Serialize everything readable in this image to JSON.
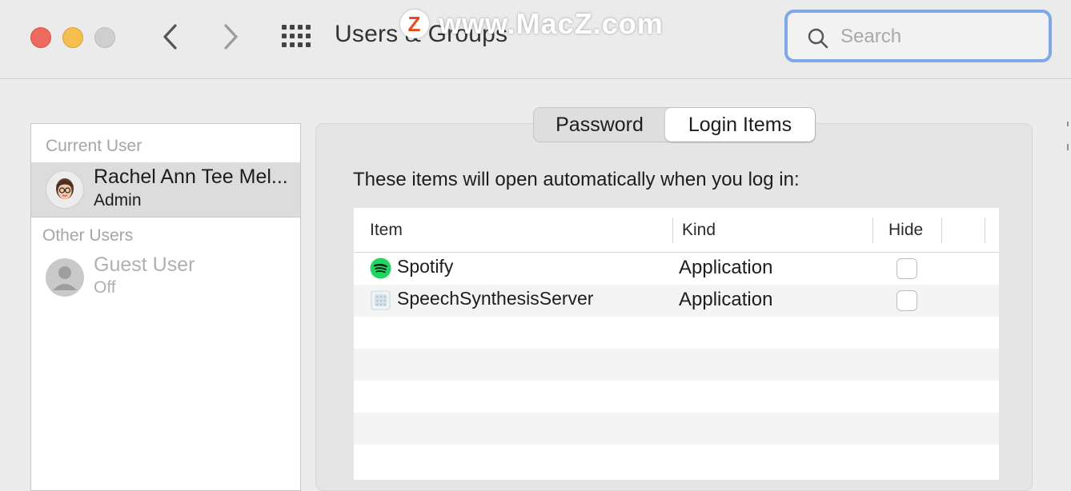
{
  "window": {
    "title": "Users & Groups",
    "watermark_text": "www.MacZ.com",
    "watermark_logo": "Z"
  },
  "toolbar": {
    "back_icon": "chevron-left-icon",
    "forward_icon": "chevron-right-icon",
    "grid_icon": "grid-icon"
  },
  "search": {
    "placeholder": "Search",
    "value": ""
  },
  "sidebar": {
    "current_user_label": "Current User",
    "current_user": {
      "name": "Rachel Ann Tee Mel...",
      "role": "Admin"
    },
    "other_users_label": "Other Users",
    "other_users": [
      {
        "name": "Guest User",
        "status": "Off"
      }
    ]
  },
  "tabs": [
    {
      "label": "Password",
      "selected": false
    },
    {
      "label": "Login Items",
      "selected": true
    }
  ],
  "login_items": {
    "description": "These items will open automatically when you log in:",
    "columns": [
      "Item",
      "Kind",
      "Hide"
    ],
    "rows": [
      {
        "item": "Spotify",
        "kind": "Application",
        "hide": false,
        "icon": "spotify-icon"
      },
      {
        "item": "SpeechSynthesisServer",
        "kind": "Application",
        "hide": false,
        "icon": "speech-synthesis-icon"
      }
    ]
  },
  "colors": {
    "close": "#ed6a5e",
    "minimize": "#f5bf4f",
    "search_focus": "#7fa9e6",
    "spotify_green": "#1ed760"
  }
}
